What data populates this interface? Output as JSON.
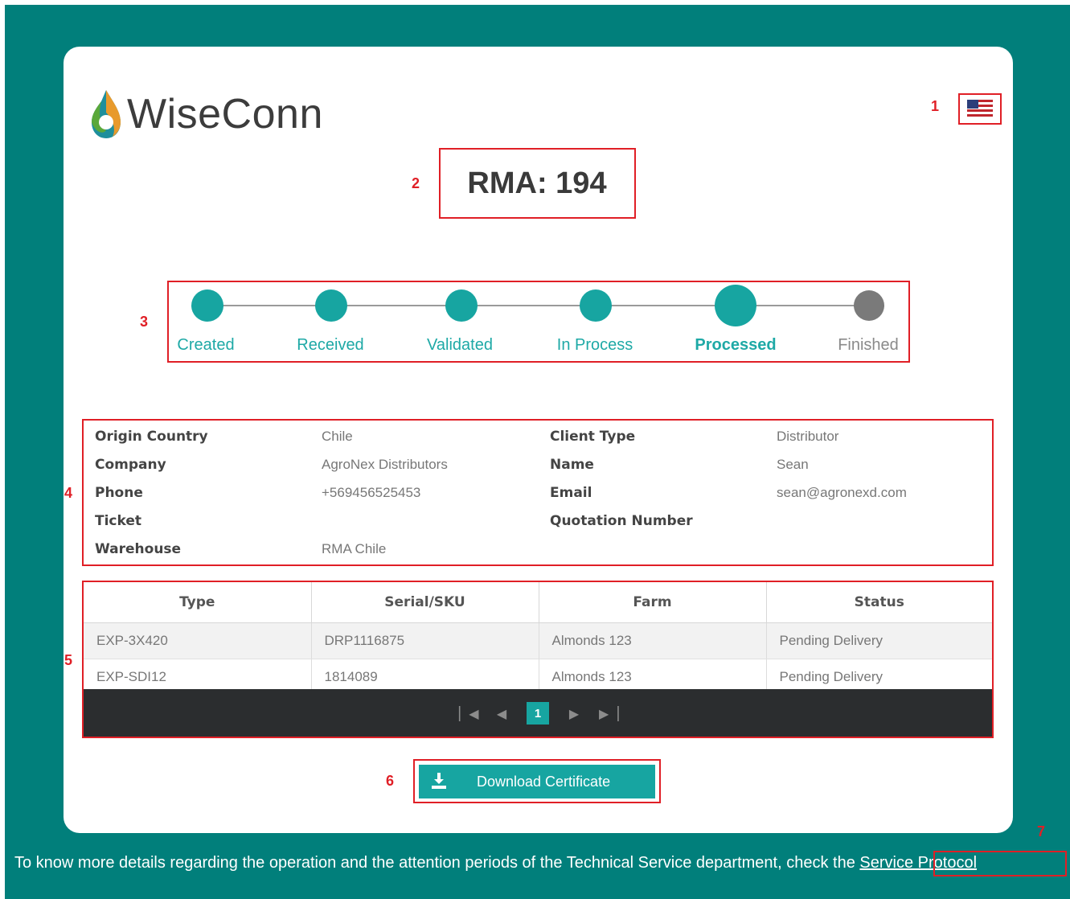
{
  "brand": {
    "name": "WiseConn"
  },
  "language": {
    "flag": "us-flag-icon"
  },
  "title": "RMA: 194",
  "markers": [
    "1",
    "2",
    "3",
    "4",
    "5",
    "6",
    "7"
  ],
  "steps": [
    {
      "label": "Created",
      "state": "done"
    },
    {
      "label": "Received",
      "state": "done"
    },
    {
      "label": "Validated",
      "state": "done"
    },
    {
      "label": "In Process",
      "state": "done"
    },
    {
      "label": "Processed",
      "state": "current"
    },
    {
      "label": "Finished",
      "state": "pending"
    }
  ],
  "info": {
    "origin_country_label": "Origin Country",
    "origin_country_value": "Chile",
    "company_label": "Company",
    "company_value": "AgroNex Distributors",
    "phone_label": "Phone",
    "phone_value": "+569456525453",
    "ticket_label": "Ticket",
    "ticket_value": "",
    "warehouse_label": "Warehouse",
    "warehouse_value": "RMA Chile",
    "client_type_label": "Client Type",
    "client_type_value": "Distributor",
    "name_label": "Name",
    "name_value": "Sean",
    "email_label": "Email",
    "email_value": "sean@agronexd.com",
    "quotation_label": "Quotation Number",
    "quotation_value": ""
  },
  "table": {
    "headers": [
      "Type",
      "Serial/SKU",
      "Farm",
      "Status"
    ],
    "rows": [
      [
        "EXP-3X420",
        "DRP1116875",
        "Almonds 123",
        "Pending Delivery"
      ],
      [
        "EXP-SDI12",
        "1814089",
        "Almonds 123",
        "Pending Delivery"
      ]
    ],
    "pagination": {
      "current_page": "1"
    }
  },
  "download_label": "Download Certificate",
  "footer": {
    "text": "To know more details regarding the operation and the attention periods of the Technical Service department, check the ",
    "link": "Service Protocol"
  },
  "colors": {
    "teal": "#017f7b",
    "accent": "#17a5a1",
    "pending": "#7a7a7a",
    "annotation": "#e01f26"
  }
}
